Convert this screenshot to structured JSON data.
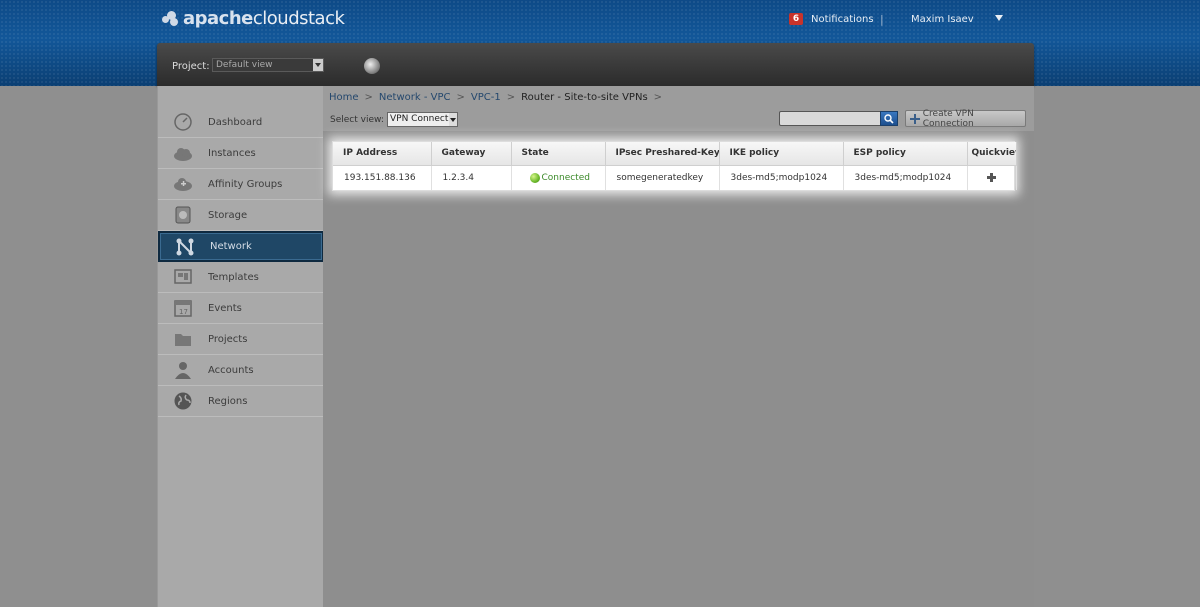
{
  "brand": {
    "logo_bold": "apache",
    "logo_light": "cloudstack"
  },
  "header": {
    "notifications_count": "6",
    "notifications_label": "Notifications",
    "separator": "|",
    "user_name": "Maxim Isaev"
  },
  "project": {
    "label": "Project:",
    "selected": "Default view"
  },
  "sidebar": {
    "items": [
      {
        "label": "Dashboard",
        "icon": "dashboard-icon"
      },
      {
        "label": "Instances",
        "icon": "cloud-icon"
      },
      {
        "label": "Affinity Groups",
        "icon": "affinity-icon"
      },
      {
        "label": "Storage",
        "icon": "storage-icon"
      },
      {
        "label": "Network",
        "icon": "network-icon",
        "active": true
      },
      {
        "label": "Templates",
        "icon": "templates-icon"
      },
      {
        "label": "Events",
        "icon": "calendar-icon"
      },
      {
        "label": "Projects",
        "icon": "folder-icon"
      },
      {
        "label": "Accounts",
        "icon": "user-icon"
      },
      {
        "label": "Regions",
        "icon": "globe-icon"
      }
    ]
  },
  "breadcrumb": {
    "items": [
      "Home",
      "Network - VPC",
      "VPC-1"
    ],
    "current": "Router - Site-to-site VPNs",
    "sep": ">"
  },
  "toolbar": {
    "select_view_label": "Select view:",
    "view_selected": "VPN Connection",
    "create_label": "Create VPN Connection"
  },
  "table": {
    "columns": [
      "IP Address",
      "Gateway",
      "State",
      "IPsec Preshared-Key",
      "IKE policy",
      "ESP policy",
      "Quickview"
    ],
    "rows": [
      {
        "ip": "193.151.88.136",
        "gateway": "1.2.3.4",
        "state": "Connected",
        "psk": "somegeneratedkey",
        "ike": "3des-md5;modp1024",
        "esp": "3des-md5;modp1024"
      }
    ]
  },
  "colors": {
    "header_blue": "#125799",
    "active_nav": "#1f4766",
    "state_green": "#3c8a2a"
  }
}
